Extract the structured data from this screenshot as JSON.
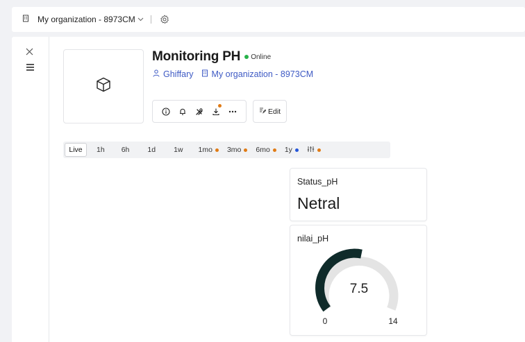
{
  "topbar": {
    "org_icon": "building-icon",
    "org_name": "My organization - 8973CM",
    "settings_icon": "gear-icon"
  },
  "sidebar": {
    "close_icon": "close-icon",
    "menu_icon": "menu-icon"
  },
  "device": {
    "thumbnail_icon": "cube-icon",
    "title": "Monitoring PH",
    "status": "Online",
    "status_color": "#27b24a",
    "owner": "Ghiffary",
    "organization": "My organization - 8973CM",
    "accent": "#3e5ac4"
  },
  "toolbar": {
    "icons": [
      "info-icon",
      "bell-icon",
      "tools-icon",
      "download-icon",
      "more-icon"
    ],
    "edit_label": "Edit"
  },
  "time_ranges": [
    {
      "label": "Live",
      "active": true,
      "dot": ""
    },
    {
      "label": "1h",
      "dot": ""
    },
    {
      "label": "6h",
      "dot": ""
    },
    {
      "label": "1d",
      "dot": ""
    },
    {
      "label": "1w",
      "dot": ""
    },
    {
      "label": "1mo",
      "dot": "#e07b15"
    },
    {
      "label": "3mo",
      "dot": "#e07b15"
    },
    {
      "label": "6mo",
      "dot": "#e07b15"
    },
    {
      "label": "1y",
      "dot": "#2556d9"
    },
    {
      "label": "custom-range-icon",
      "dot": "#e07b15"
    }
  ],
  "widgets": {
    "status": {
      "label": "Status_pH",
      "value": "Netral"
    },
    "gauge": {
      "label": "nilai_pH",
      "value": "7.5",
      "min": "0",
      "max": "14",
      "fill_color": "#0f2b2a",
      "track_color": "#e4e4e4"
    }
  }
}
